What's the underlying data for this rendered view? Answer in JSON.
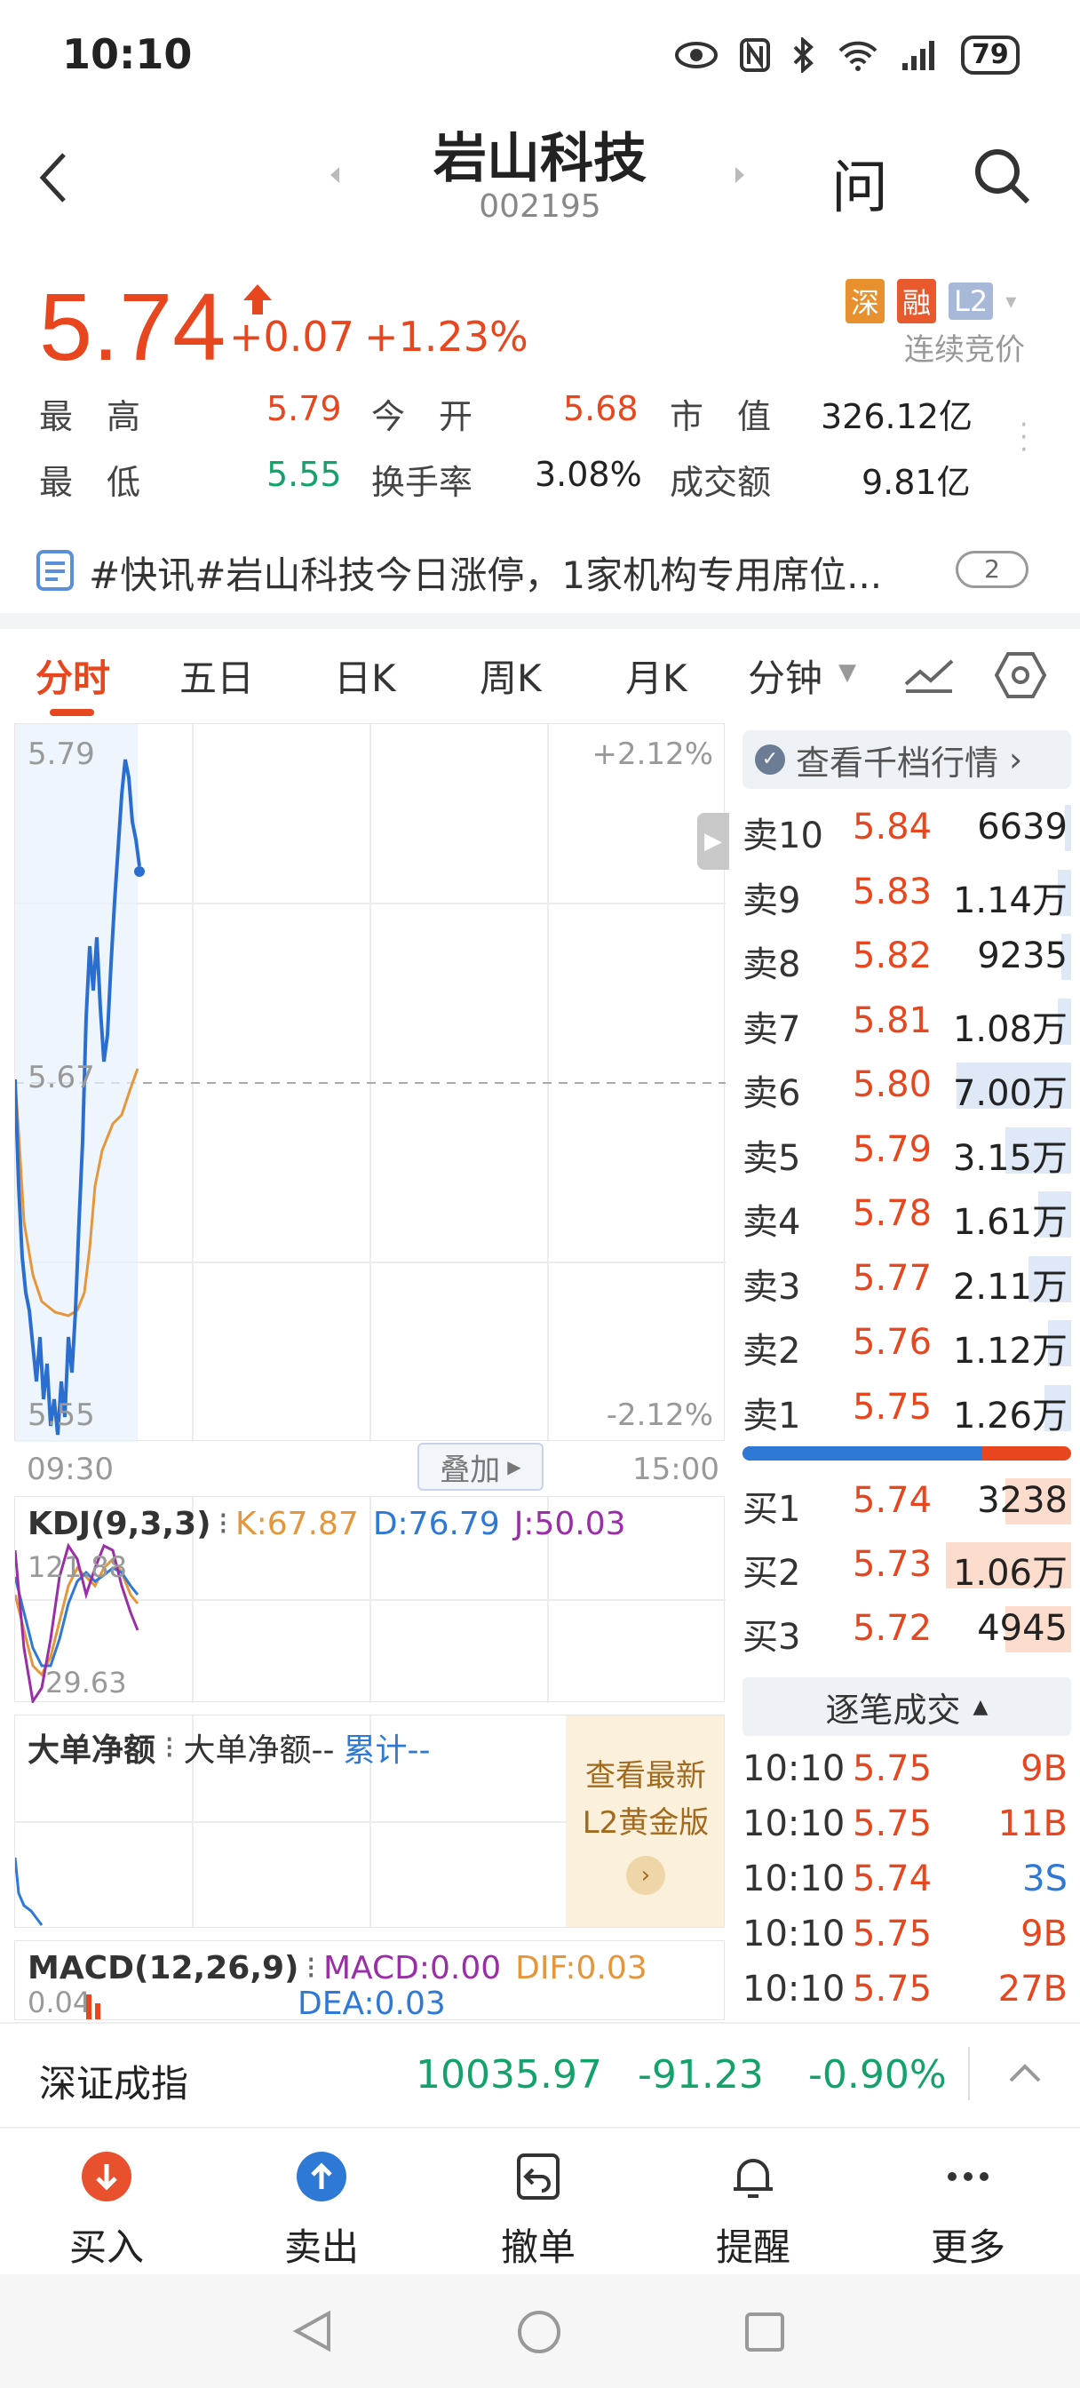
{
  "status_bar": {
    "time": "10:10",
    "battery": "79"
  },
  "header": {
    "title": "岩山科技",
    "code": "002195",
    "ask_label": "问"
  },
  "quote": {
    "price": "5.74",
    "change": "+0.07",
    "change_pct": "+1.23%",
    "badges": [
      "深",
      "融",
      "L2"
    ],
    "trade_status": "连续竞价",
    "stats": [
      {
        "label": "最　高",
        "value": "5.79",
        "color": "red"
      },
      {
        "label": "今　开",
        "value": "5.68",
        "color": "red"
      },
      {
        "label": "市　值",
        "value": "326.12亿",
        "color": "dark"
      },
      {
        "label": "最　低",
        "value": "5.55",
        "color": "green"
      },
      {
        "label": "换手率",
        "value": "3.08%",
        "color": "dark"
      },
      {
        "label": "成交额",
        "value": "9.81亿",
        "color": "dark"
      }
    ]
  },
  "news": {
    "text": "#快讯#岩山科技今日涨停，1家机构专用席位...",
    "count": "2"
  },
  "tabs": [
    "分时",
    "五日",
    "日K",
    "周K",
    "月K",
    "分钟"
  ],
  "intraday": {
    "y_top": "5.79",
    "y_mid": "5.67",
    "y_bottom": "5.55",
    "pct_top": "+2.12%",
    "pct_bottom": "-2.12%",
    "time_start": "09:30",
    "time_end": "15:00",
    "overlay_label": "叠加"
  },
  "kdj": {
    "name": "KDJ(9,3,3)",
    "k": "K:67.87",
    "d": "D:76.79",
    "j": "J:50.03",
    "hi": "121.88",
    "lo": "29.63"
  },
  "big_order": {
    "title": "大单净额",
    "item": "大单净额--",
    "cum": "累计--",
    "promo_line1": "查看最新",
    "promo_line2": "L2黄金版"
  },
  "macd": {
    "name": "MACD(12,26,9)",
    "macd": "MACD:0.00",
    "dif": "DIF:0.03",
    "dea": "DEA:0.03",
    "lo": "0.04"
  },
  "order_book": {
    "header": "查看千档行情",
    "asks": [
      {
        "label": "卖10",
        "price": "5.84",
        "vol": "6639",
        "fill": 0.02
      },
      {
        "label": "卖9",
        "price": "5.83",
        "vol": "1.14万",
        "fill": 0.04
      },
      {
        "label": "卖8",
        "price": "5.82",
        "vol": "9235",
        "fill": 0.03
      },
      {
        "label": "卖7",
        "price": "5.81",
        "vol": "1.08万",
        "fill": 0.04
      },
      {
        "label": "卖6",
        "price": "5.80",
        "vol": "7.00万",
        "fill": 0.35
      },
      {
        "label": "卖5",
        "price": "5.79",
        "vol": "3.15万",
        "fill": 0.2
      },
      {
        "label": "卖4",
        "price": "5.78",
        "vol": "1.61万",
        "fill": 0.1
      },
      {
        "label": "卖3",
        "price": "5.77",
        "vol": "2.11万",
        "fill": 0.13
      },
      {
        "label": "卖2",
        "price": "5.76",
        "vol": "1.12万",
        "fill": 0.07
      },
      {
        "label": "卖1",
        "price": "5.75",
        "vol": "1.26万",
        "fill": 0.08
      }
    ],
    "bid_ratio": 0.73,
    "bids": [
      {
        "label": "买1",
        "price": "5.74",
        "vol": "3238",
        "fill": 0.2
      },
      {
        "label": "买2",
        "price": "5.73",
        "vol": "1.06万",
        "fill": 0.38
      },
      {
        "label": "买3",
        "price": "5.72",
        "vol": "4945",
        "fill": 0.2
      }
    ]
  },
  "trades": {
    "header": "逐笔成交",
    "rows": [
      {
        "time": "10:10",
        "price": "5.75",
        "vol": "9B",
        "side": "B"
      },
      {
        "time": "10:10",
        "price": "5.75",
        "vol": "11B",
        "side": "B"
      },
      {
        "time": "10:10",
        "price": "5.74",
        "vol": "3S",
        "side": "S"
      },
      {
        "time": "10:10",
        "price": "5.75",
        "vol": "9B",
        "side": "B"
      },
      {
        "time": "10:10",
        "price": "5.75",
        "vol": "27B",
        "side": "B"
      }
    ]
  },
  "index_bar": {
    "name": "深证成指",
    "value": "10035.97",
    "change": "-91.23",
    "pct": "-0.90%"
  },
  "bottom_nav": [
    {
      "label": "买入",
      "icon": "arrow-down-circle-icon"
    },
    {
      "label": "卖出",
      "icon": "arrow-up-circle-icon"
    },
    {
      "label": "撤单",
      "icon": "undo-icon"
    },
    {
      "label": "提醒",
      "icon": "bell-icon"
    },
    {
      "label": "更多",
      "icon": "more-icon"
    }
  ],
  "colors": {
    "up": "#e8461e",
    "down": "#13a36a",
    "accent_blue": "#2e78d6"
  }
}
